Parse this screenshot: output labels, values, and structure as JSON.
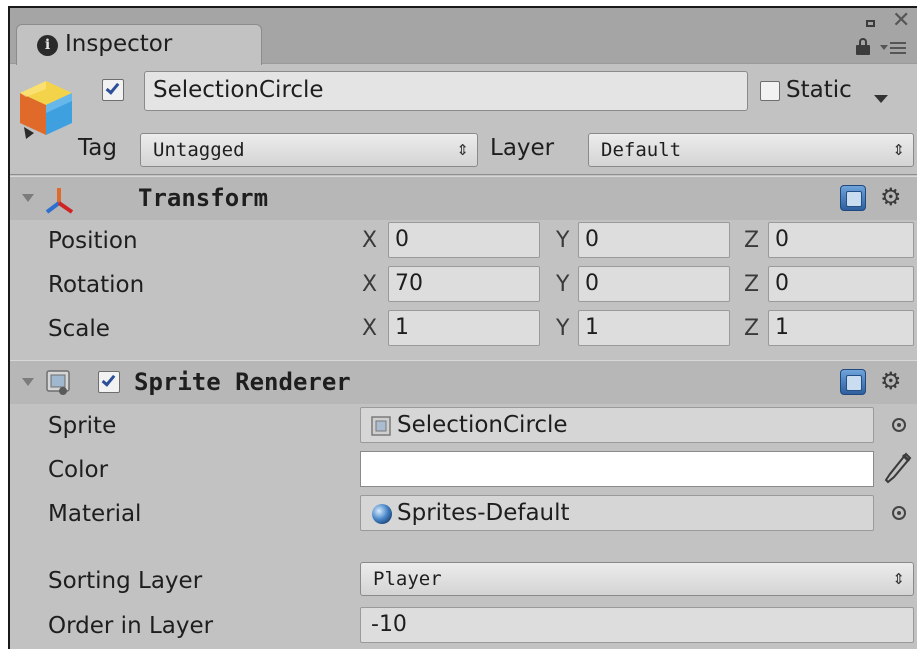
{
  "window": {
    "tab_label": "Inspector"
  },
  "header": {
    "active": true,
    "name": "SelectionCircle",
    "static_label": "Static",
    "static_checked": false,
    "tag_label": "Tag",
    "tag_value": "Untagged",
    "layer_label": "Layer",
    "layer_value": "Default"
  },
  "transform": {
    "title": "Transform",
    "rows": [
      {
        "label": "Position",
        "x": "0",
        "y": "0",
        "z": "0"
      },
      {
        "label": "Rotation",
        "x": "70",
        "y": "0",
        "z": "0"
      },
      {
        "label": "Scale",
        "x": "1",
        "y": "1",
        "z": "1"
      }
    ],
    "axis_labels": {
      "x": "X",
      "y": "Y",
      "z": "Z"
    }
  },
  "sprite_renderer": {
    "title": "Sprite Renderer",
    "enabled": true,
    "sprite_label": "Sprite",
    "sprite_value": "SelectionCircle",
    "color_label": "Color",
    "color_value": "#ffffff",
    "material_label": "Material",
    "material_value": "Sprites-Default",
    "sorting_layer_label": "Sorting Layer",
    "sorting_layer_value": "Player",
    "order_label": "Order in Layer",
    "order_value": "-10"
  },
  "colors": {
    "panel_bg": "#c2c2c2",
    "checkmark": "#2c4f99"
  }
}
